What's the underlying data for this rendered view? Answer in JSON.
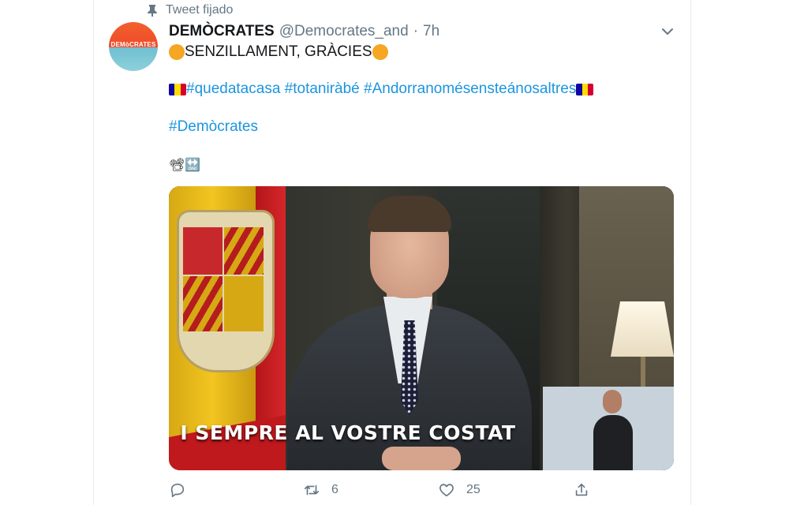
{
  "pinned": {
    "label": "Tweet fijado"
  },
  "tweet": {
    "display_name": "DEMÒCRATES",
    "handle": "@Democrates_and",
    "separator": "·",
    "time": "7h",
    "avatar_text": "DEMòCRATES",
    "text_line1": "SENZILLAMENT, GRÀCIES",
    "hashtags": [
      "#quedatacasa",
      "#totaniràbé",
      "#Andorranomésensteánosaltres"
    ],
    "hashtag_demo": "#Demòcrates",
    "media_icons": "📽🔛"
  },
  "video": {
    "subtitle": "I SEMPRE AL VOSTRE COSTAT"
  },
  "actions": {
    "reply_count": "",
    "retweet_count": "6",
    "like_count": "25"
  },
  "colors": {
    "link": "#1b95e0",
    "muted": "#657786",
    "text": "#14171a"
  }
}
